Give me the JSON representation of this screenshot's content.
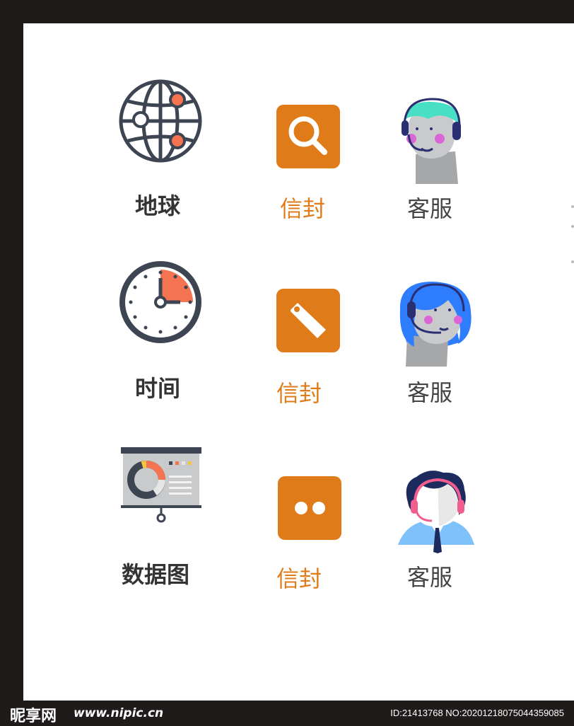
{
  "labels": {
    "row1_col1": "地球",
    "row1_col2": "信封",
    "row1_col3": "客服",
    "row2_col1": "时间",
    "row2_col2": "信封",
    "row2_col3": "客服",
    "row3_col1": "数据图",
    "row3_col2": "信封",
    "row3_col3": "客服"
  },
  "icons": {
    "row1_col1": "globe-icon",
    "row1_col2": "search-icon",
    "row1_col3": "customer-service-avatar-icon",
    "row2_col1": "clock-icon",
    "row2_col2": "tag-icon",
    "row2_col3": "customer-service-avatar-icon",
    "row3_col1": "presentation-chart-icon",
    "row3_col2": "chat-dots-icon",
    "row3_col3": "customer-service-avatar-icon"
  },
  "colors": {
    "accent_orange": "#e07b1a",
    "icon_dark": "#3d4452",
    "highlight_coral": "#f47350",
    "background": "#ffffff",
    "frame": "#1e1b1a"
  },
  "watermark": {
    "brand": "昵享网",
    "site": "www.nipic.cn",
    "id_text": "ID:21413768 NO:20201218075044359085"
  }
}
